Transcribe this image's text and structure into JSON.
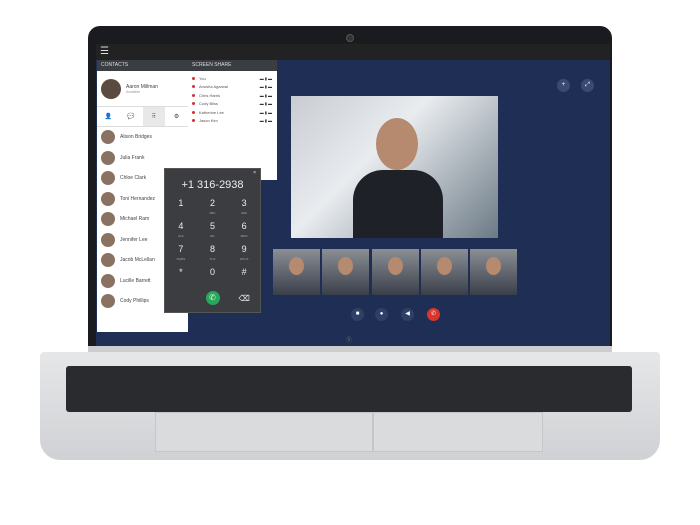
{
  "contacts_panel": {
    "title": "CONTACTS",
    "user": {
      "name": "Aaron Millman",
      "status": "Available"
    },
    "tabs": [
      "person-icon",
      "chat-icon",
      "dialpad-icon",
      "settings-icon"
    ],
    "items": [
      {
        "name": "Alison Bridges"
      },
      {
        "name": "Julia Frank"
      },
      {
        "name": "Chloe Clark"
      },
      {
        "name": "Toni Hernandez"
      },
      {
        "name": "Michael Ram"
      },
      {
        "name": "Jennifer Lee"
      },
      {
        "name": "Jacob McLellan"
      },
      {
        "name": "Lucille Barrett"
      },
      {
        "name": "Cody Phillips"
      }
    ]
  },
  "share_panel": {
    "title": "SCREEN SHARE",
    "participants": [
      "You",
      "Anusha Agarwal",
      "Chris Harris",
      "Cody Bliss",
      "Katherine Lee",
      "Jason Kim"
    ]
  },
  "dialpad": {
    "number": "+1 316-2938",
    "keys": [
      {
        "d": "1",
        "l": ""
      },
      {
        "d": "2",
        "l": "ABC"
      },
      {
        "d": "3",
        "l": "DEF"
      },
      {
        "d": "4",
        "l": "GHI"
      },
      {
        "d": "5",
        "l": "JKL"
      },
      {
        "d": "6",
        "l": "MNO"
      },
      {
        "d": "7",
        "l": "PQRS"
      },
      {
        "d": "8",
        "l": "TUV"
      },
      {
        "d": "9",
        "l": "WXYZ"
      },
      {
        "d": "*",
        "l": ""
      },
      {
        "d": "0",
        "l": ""
      },
      {
        "d": "#",
        "l": ""
      }
    ]
  },
  "brand": "hp"
}
